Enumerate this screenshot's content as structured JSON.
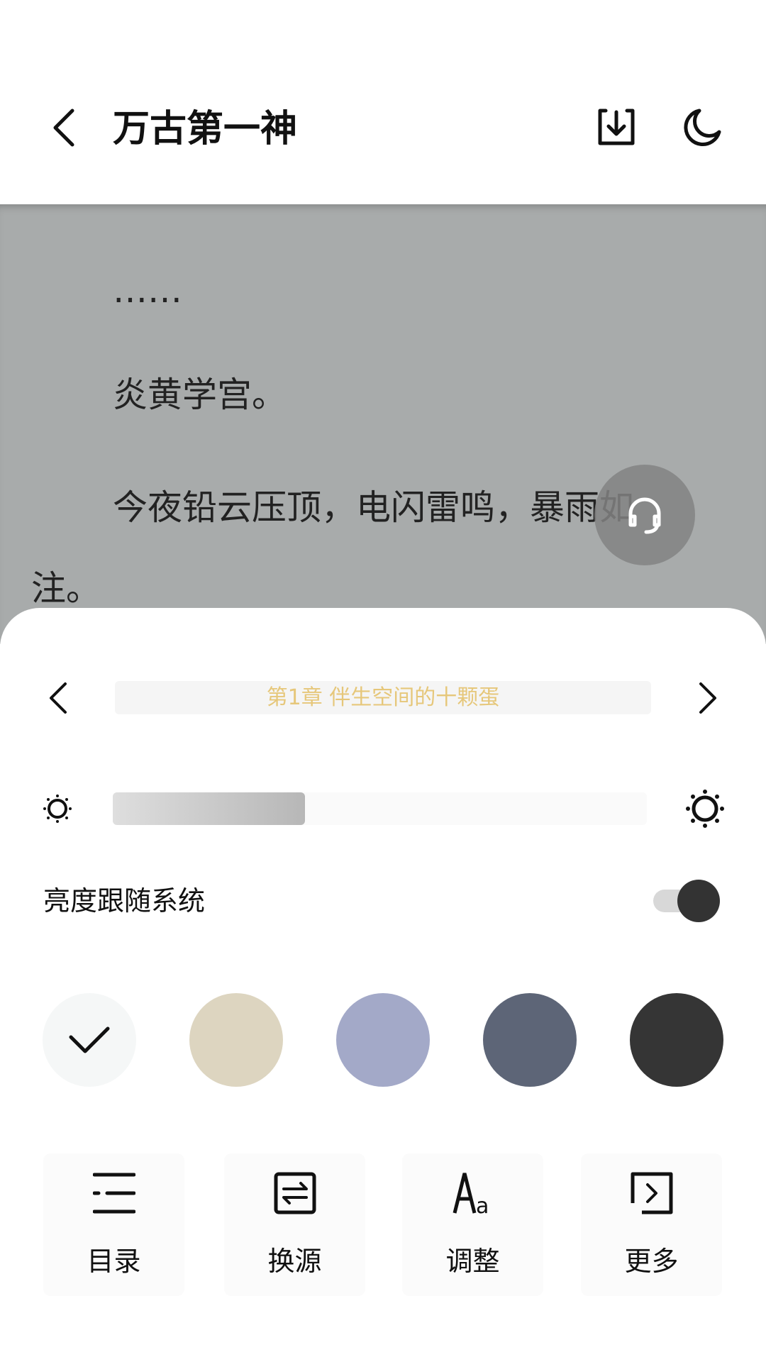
{
  "header": {
    "title": "万古第一神",
    "back_icon": "chevron-left-icon",
    "download_icon": "download-icon",
    "night_icon": "moon-icon"
  },
  "reader": {
    "lines": [
      "……",
      "炎黄学宫。",
      "今夜铅云压顶，电闪雷鸣，暴雨如",
      "注。"
    ],
    "audio_icon": "headset-icon"
  },
  "sheet": {
    "chapter": {
      "title": "第1章 伴生空间的十颗蛋"
    },
    "brightness": {
      "level_percent": 36
    },
    "follow_system": {
      "label": "亮度跟随系统",
      "enabled": true
    },
    "themes": {
      "colors": [
        "#f5f7f7",
        "#ddd5c0",
        "#a3a9c8",
        "#5d6577",
        "#353535"
      ],
      "selected_index": 0
    },
    "tools": [
      {
        "label": "目录",
        "icon": "list-icon"
      },
      {
        "label": "换源",
        "icon": "switch-source-icon"
      },
      {
        "label": "调整",
        "icon": "font-size-icon"
      },
      {
        "label": "更多",
        "icon": "more-icon"
      }
    ]
  }
}
